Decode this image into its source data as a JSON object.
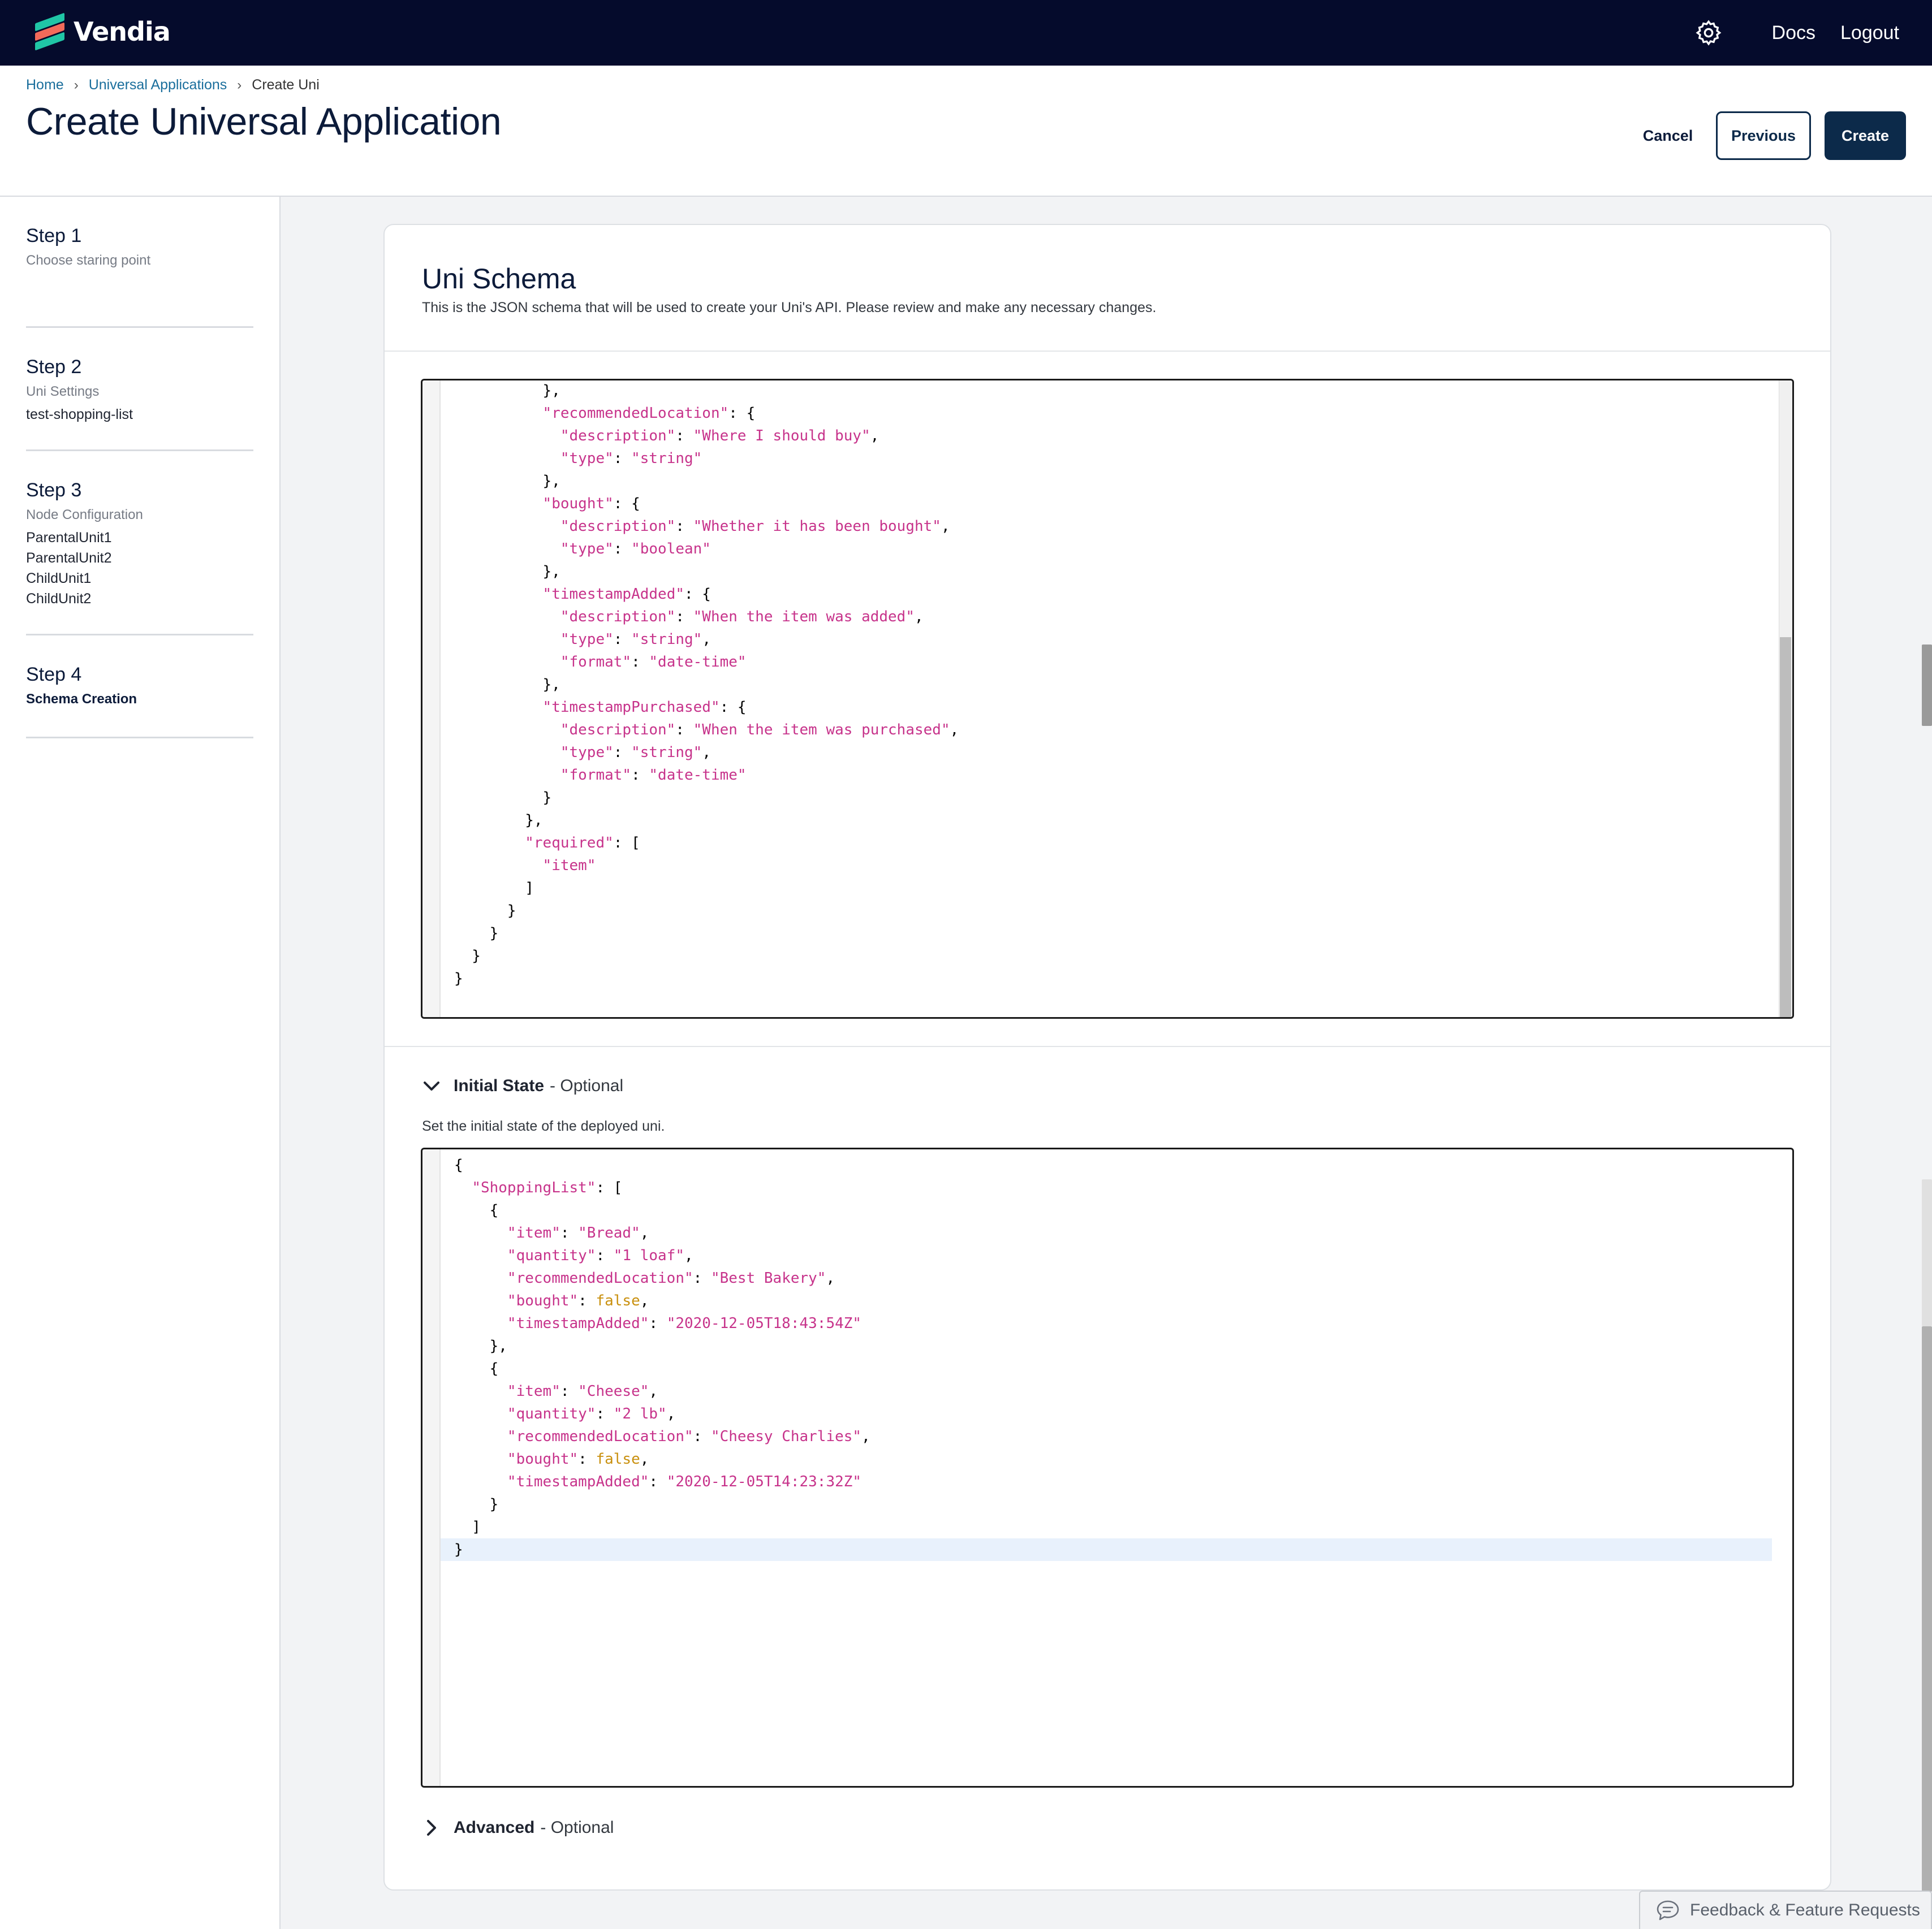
{
  "brand": {
    "name": "Vendia"
  },
  "nav": {
    "docs": "Docs",
    "logout": "Logout"
  },
  "breadcrumb": {
    "home": "Home",
    "apps": "Universal Applications",
    "current": "Create Uni"
  },
  "header": {
    "title": "Create Universal Application",
    "cancel": "Cancel",
    "previous": "Previous",
    "create": "Create"
  },
  "steps": [
    {
      "title": "Step 1",
      "subtitle": "Choose staring point",
      "values": []
    },
    {
      "title": "Step 2",
      "subtitle": "Uni Settings",
      "values": [
        "test-shopping-list"
      ]
    },
    {
      "title": "Step 3",
      "subtitle": "Node Configuration",
      "values": [
        "ParentalUnit1",
        "ParentalUnit2",
        "ChildUnit1",
        "ChildUnit2"
      ]
    },
    {
      "title": "Step 4",
      "subtitle": "Schema Creation",
      "values": []
    }
  ],
  "schema": {
    "title": "Uni Schema",
    "description": "This is the JSON schema that will be used to create your Uni's API. Please review and make any necessary changes.",
    "lines": [
      [
        [
          "p",
          "          },"
        ]
      ],
      [
        [
          "p",
          "          "
        ],
        [
          "k",
          "\"recommendedLocation\""
        ],
        [
          "p",
          ": {"
        ]
      ],
      [
        [
          "p",
          "            "
        ],
        [
          "k",
          "\"description\""
        ],
        [
          "p",
          ": "
        ],
        [
          "s",
          "\"Where I should buy\""
        ],
        [
          "p",
          ","
        ]
      ],
      [
        [
          "p",
          "            "
        ],
        [
          "k",
          "\"type\""
        ],
        [
          "p",
          ": "
        ],
        [
          "s",
          "\"string\""
        ]
      ],
      [
        [
          "p",
          "          },"
        ]
      ],
      [
        [
          "p",
          "          "
        ],
        [
          "k",
          "\"bought\""
        ],
        [
          "p",
          ": {"
        ]
      ],
      [
        [
          "p",
          "            "
        ],
        [
          "k",
          "\"description\""
        ],
        [
          "p",
          ": "
        ],
        [
          "s",
          "\"Whether it has been bought\""
        ],
        [
          "p",
          ","
        ]
      ],
      [
        [
          "p",
          "            "
        ],
        [
          "k",
          "\"type\""
        ],
        [
          "p",
          ": "
        ],
        [
          "s",
          "\"boolean\""
        ]
      ],
      [
        [
          "p",
          "          },"
        ]
      ],
      [
        [
          "p",
          "          "
        ],
        [
          "k",
          "\"timestampAdded\""
        ],
        [
          "p",
          ": {"
        ]
      ],
      [
        [
          "p",
          "            "
        ],
        [
          "k",
          "\"description\""
        ],
        [
          "p",
          ": "
        ],
        [
          "s",
          "\"When the item was added\""
        ],
        [
          "p",
          ","
        ]
      ],
      [
        [
          "p",
          "            "
        ],
        [
          "k",
          "\"type\""
        ],
        [
          "p",
          ": "
        ],
        [
          "s",
          "\"string\""
        ],
        [
          "p",
          ","
        ]
      ],
      [
        [
          "p",
          "            "
        ],
        [
          "k",
          "\"format\""
        ],
        [
          "p",
          ": "
        ],
        [
          "s",
          "\"date-time\""
        ]
      ],
      [
        [
          "p",
          "          },"
        ]
      ],
      [
        [
          "p",
          "          "
        ],
        [
          "k",
          "\"timestampPurchased\""
        ],
        [
          "p",
          ": {"
        ]
      ],
      [
        [
          "p",
          "            "
        ],
        [
          "k",
          "\"description\""
        ],
        [
          "p",
          ": "
        ],
        [
          "s",
          "\"When the item was purchased\""
        ],
        [
          "p",
          ","
        ]
      ],
      [
        [
          "p",
          "            "
        ],
        [
          "k",
          "\"type\""
        ],
        [
          "p",
          ": "
        ],
        [
          "s",
          "\"string\""
        ],
        [
          "p",
          ","
        ]
      ],
      [
        [
          "p",
          "            "
        ],
        [
          "k",
          "\"format\""
        ],
        [
          "p",
          ": "
        ],
        [
          "s",
          "\"date-time\""
        ]
      ],
      [
        [
          "p",
          "          }"
        ]
      ],
      [
        [
          "p",
          "        },"
        ]
      ],
      [
        [
          "p",
          "        "
        ],
        [
          "k",
          "\"required\""
        ],
        [
          "p",
          ": ["
        ]
      ],
      [
        [
          "p",
          "          "
        ],
        [
          "s",
          "\"item\""
        ]
      ],
      [
        [
          "p",
          "        ]"
        ]
      ],
      [
        [
          "p",
          "      }"
        ]
      ],
      [
        [
          "p",
          "    }"
        ]
      ],
      [
        [
          "p",
          "  }"
        ]
      ],
      [
        [
          "p",
          "}"
        ]
      ]
    ]
  },
  "initial_state": {
    "label": "Initial State",
    "optional": "- Optional",
    "description": "Set the initial state of the deployed uni.",
    "lines": [
      [
        [
          "p",
          "{"
        ]
      ],
      [
        [
          "p",
          "  "
        ],
        [
          "k",
          "\"ShoppingList\""
        ],
        [
          "p",
          ": ["
        ]
      ],
      [
        [
          "p",
          "    {"
        ]
      ],
      [
        [
          "p",
          "      "
        ],
        [
          "k",
          "\"item\""
        ],
        [
          "p",
          ": "
        ],
        [
          "s",
          "\"Bread\""
        ],
        [
          "p",
          ","
        ]
      ],
      [
        [
          "p",
          "      "
        ],
        [
          "k",
          "\"quantity\""
        ],
        [
          "p",
          ": "
        ],
        [
          "s",
          "\"1 loaf\""
        ],
        [
          "p",
          ","
        ]
      ],
      [
        [
          "p",
          "      "
        ],
        [
          "k",
          "\"recommendedLocation\""
        ],
        [
          "p",
          ": "
        ],
        [
          "s",
          "\"Best Bakery\""
        ],
        [
          "p",
          ","
        ]
      ],
      [
        [
          "p",
          "      "
        ],
        [
          "k",
          "\"bought\""
        ],
        [
          "p",
          ": "
        ],
        [
          "b",
          "false"
        ],
        [
          "p",
          ","
        ]
      ],
      [
        [
          "p",
          "      "
        ],
        [
          "k",
          "\"timestampAdded\""
        ],
        [
          "p",
          ": "
        ],
        [
          "s",
          "\"2020-12-05T18:43:54Z\""
        ]
      ],
      [
        [
          "p",
          "    },"
        ]
      ],
      [
        [
          "p",
          "    {"
        ]
      ],
      [
        [
          "p",
          "      "
        ],
        [
          "k",
          "\"item\""
        ],
        [
          "p",
          ": "
        ],
        [
          "s",
          "\"Cheese\""
        ],
        [
          "p",
          ","
        ]
      ],
      [
        [
          "p",
          "      "
        ],
        [
          "k",
          "\"quantity\""
        ],
        [
          "p",
          ": "
        ],
        [
          "s",
          "\"2 lb\""
        ],
        [
          "p",
          ","
        ]
      ],
      [
        [
          "p",
          "      "
        ],
        [
          "k",
          "\"recommendedLocation\""
        ],
        [
          "p",
          ": "
        ],
        [
          "s",
          "\"Cheesy Charlies\""
        ],
        [
          "p",
          ","
        ]
      ],
      [
        [
          "p",
          "      "
        ],
        [
          "k",
          "\"bought\""
        ],
        [
          "p",
          ": "
        ],
        [
          "b",
          "false"
        ],
        [
          "p",
          ","
        ]
      ],
      [
        [
          "p",
          "      "
        ],
        [
          "k",
          "\"timestampAdded\""
        ],
        [
          "p",
          ": "
        ],
        [
          "s",
          "\"2020-12-05T14:23:32Z\""
        ]
      ],
      [
        [
          "p",
          "    }"
        ]
      ],
      [
        [
          "p",
          "  ]"
        ]
      ],
      [
        [
          "p",
          "}"
        ]
      ]
    ]
  },
  "advanced": {
    "label": "Advanced",
    "optional": "- Optional"
  },
  "feedback": {
    "label": "Feedback & Feature Requests"
  },
  "colors": {
    "nav_bg": "#050b2c",
    "primary": "#0c2a4a",
    "link": "#1a6e9c",
    "json_key": "#c7338b",
    "json_bool": "#c9900e"
  }
}
